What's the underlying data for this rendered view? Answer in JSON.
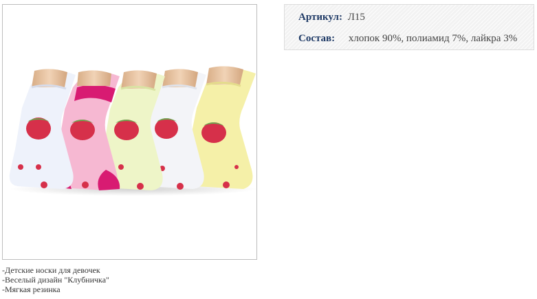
{
  "product": {
    "image_alt": "socks-product-photo",
    "specs": {
      "article_label": "Артикул:",
      "article_value": "Л15",
      "composition_label": "Состав:",
      "composition_value": "хлопок 90%, полиамид 7%, лайкра 3%"
    },
    "description": [
      "-Детские носки для девочек",
      "-Веселый дизайн \"Клубничка\"",
      "-Мягкая резинка"
    ]
  },
  "colors": {
    "label": "#1f3a66",
    "frame_border": "#bdbdbd",
    "sock_white": "#eef2fb",
    "sock_pink": "#f6b8d2",
    "sock_magenta": "#d81b72",
    "sock_lime": "#eef5c8",
    "sock_cream": "#f5f0a8",
    "strawberry": "#d6304a",
    "leaf": "#6aa84f",
    "skin": "#e9c7a6"
  }
}
